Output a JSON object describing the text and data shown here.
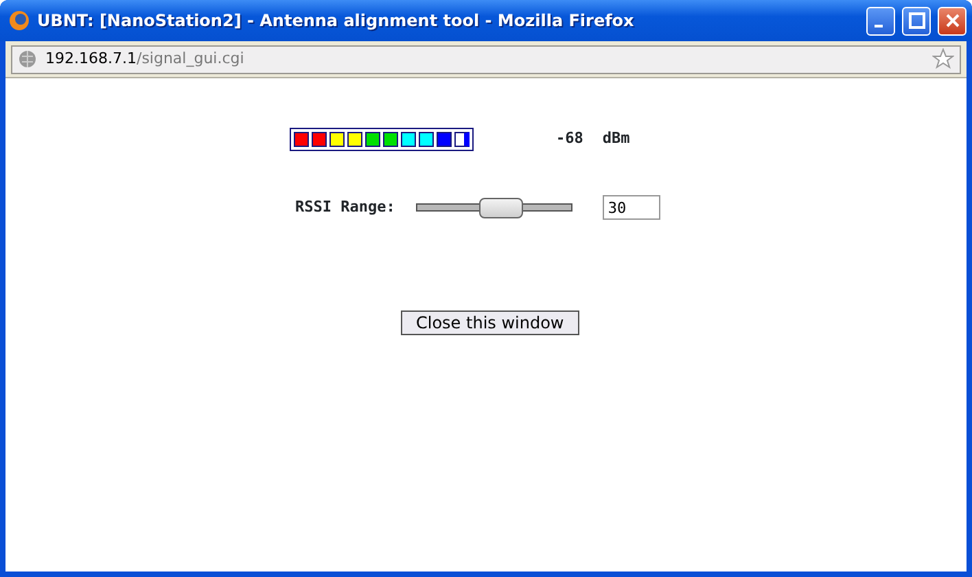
{
  "window": {
    "title": "UBNT: [NanoStation2] - Antenna alignment tool - Mozilla Firefox"
  },
  "address_bar": {
    "host": "192.168.7.1",
    "path": "/signal_gui.cgi"
  },
  "signal_meter": {
    "segments": [
      {
        "color": "#ff0000",
        "on": true
      },
      {
        "color": "#ff0000",
        "on": true
      },
      {
        "color": "#ffff00",
        "on": true
      },
      {
        "color": "#ffff00",
        "on": true
      },
      {
        "color": "#00e000",
        "on": true
      },
      {
        "color": "#00e000",
        "on": true
      },
      {
        "color": "#00ffff",
        "on": true
      },
      {
        "color": "#00ffff",
        "on": true
      },
      {
        "color": "#0000ff",
        "on": true
      },
      {
        "color": "#0000ff",
        "on": false
      }
    ],
    "value": "-68",
    "unit": "dBm"
  },
  "rssi_range": {
    "label": "RSSI Range:",
    "level": 0.55,
    "value": "30"
  },
  "close_button": "Close this window"
}
